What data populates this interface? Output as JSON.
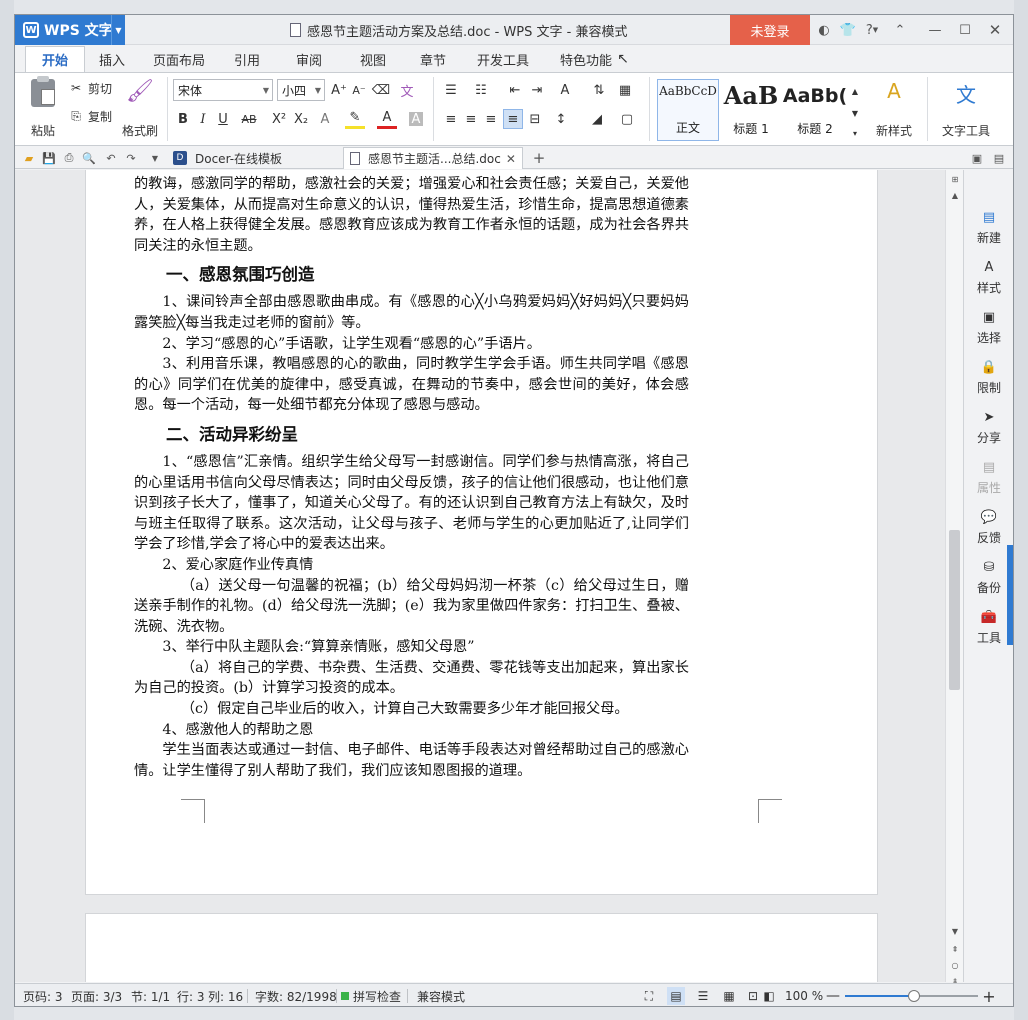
{
  "app": {
    "name": "WPS 文字",
    "window_title": "感恩节主题活动方案及总结.doc - WPS 文字 - 兼容模式",
    "login_label": "未登录",
    "help_label": "?"
  },
  "ribbon_tabs": [
    "开始",
    "插入",
    "页面布局",
    "引用",
    "审阅",
    "视图",
    "章节",
    "开发工具",
    "特色功能"
  ],
  "toolbar": {
    "paste": "粘贴",
    "cut": "剪切",
    "copy": "复制",
    "format_painter": "格式刷",
    "font_name": "宋体",
    "font_size": "小四",
    "styles": [
      {
        "preview": "AaBbCcD",
        "name": "正文"
      },
      {
        "preview": "AaB",
        "name": "标题 1"
      },
      {
        "preview": "AaBb(",
        "name": "标题 2"
      }
    ],
    "new_style": "新样式",
    "text_tools": "文字工具"
  },
  "doc_tabs": [
    "Docer-在线模板",
    "感恩节主题活...总结.doc"
  ],
  "document": {
    "intro": [
      "的教诲，感激同学的帮助，感激社会的关爱；增强爱心和社会责任感；关爱自己，关爱他人，关爱集体，从而提高对生命意义的认识，懂得热爱生活，珍惜生命，提高思想道德素养，在人格上获得健全发展。感恩教育应该成为教育工作者永恒的话题，成为社会各界共同关注的永恒主题。"
    ],
    "section1_title": "一、感恩氛围巧创造",
    "section1": [
      "1、课间铃声全部由感恩歌曲串成。有《感恩的心╳小乌鸦爱妈妈╳好妈妈╳只要妈妈露笑脸╳每当我走过老师的窗前》等。",
      "2、学习“感恩的心”手语歌，让学生观看“感恩的心”手语片。",
      "3、利用音乐课，教唱感恩的心的歌曲，同时教学生学会手语。师生共同学唱《感恩的心》同学们在优美的旋律中，感受真诚，在舞动的节奏中，感会世间的美好，体会感恩。每一个活动，每一处细节都充分体现了感恩与感动。"
    ],
    "section2_title": "二、活动异彩纷呈",
    "section2": {
      "p1": "1、“感恩信”汇亲情。组织学生给父母写一封感谢信。同学们参与热情高涨，将自己的心里话用书信向父母尽情表达；同时由父母反馈，孩子的信让他们很感动，也让他们意识到孩子长大了，懂事了，知道关心父母了。有的还认识到自己教育方法上有缺欠，及时与班主任取得了联系。这次活动，让父母与孩子、老师与学生的心更加贴近了,让同学们学会了珍惜,学会了将心中的爱表达出来。",
      "p2": "2、爱心家庭作业传真情",
      "p3": "（a）送父母一句温馨的祝福；(b）给父母妈妈沏一杯茶（c）给父母过生日，赠送亲手制作的礼物。(d）给父母洗一洗脚；(e）我为家里做四件家务：打扫卫生、叠被、洗碗、洗衣物。",
      "p4": "3、举行中队主题队会:“算算亲情账，感知父母恩”",
      "p5": "（a）将自己的学费、书杂费、生活费、交通费、零花钱等支出加起来，算出家长为自己的投资。(b）计算学习投资的成本。",
      "p6": "（c）假定自己毕业后的收入，计算自己大致需要多少年才能回报父母。",
      "p7": "4、感激他人的帮助之恩",
      "p8": "学生当面表达或通过一封信、电子邮件、电话等手段表达对曾经帮助过自己的感激心情。让学生懂得了别人帮助了我们，我们应该知恩图报的道理。"
    }
  },
  "side_panel": [
    {
      "label": "新建",
      "icon": "new-doc-icon",
      "enabled": true
    },
    {
      "label": "样式",
      "icon": "style-icon",
      "enabled": true
    },
    {
      "label": "选择",
      "icon": "select-icon",
      "enabled": true
    },
    {
      "label": "限制",
      "icon": "restrict-icon",
      "enabled": true
    },
    {
      "label": "分享",
      "icon": "share-icon",
      "enabled": true
    },
    {
      "label": "属性",
      "icon": "properties-icon",
      "enabled": false
    },
    {
      "label": "反馈",
      "icon": "feedback-icon",
      "enabled": true
    },
    {
      "label": "备份",
      "icon": "backup-icon",
      "enabled": true
    },
    {
      "label": "工具",
      "icon": "toolbox-icon",
      "enabled": true
    }
  ],
  "status": {
    "page_code": "页码: 3",
    "pages": "页面: 3/3",
    "section": "节: 1/1",
    "row": "行: 3",
    "col": "列: 16",
    "words": "字数: 82/1998",
    "spell": "拼写检查",
    "mode": "兼容模式",
    "zoom": "100 %",
    "zoom_fraction": 0.52
  },
  "colors": {
    "accent": "#2f7ad1",
    "login": "#e5614a"
  }
}
